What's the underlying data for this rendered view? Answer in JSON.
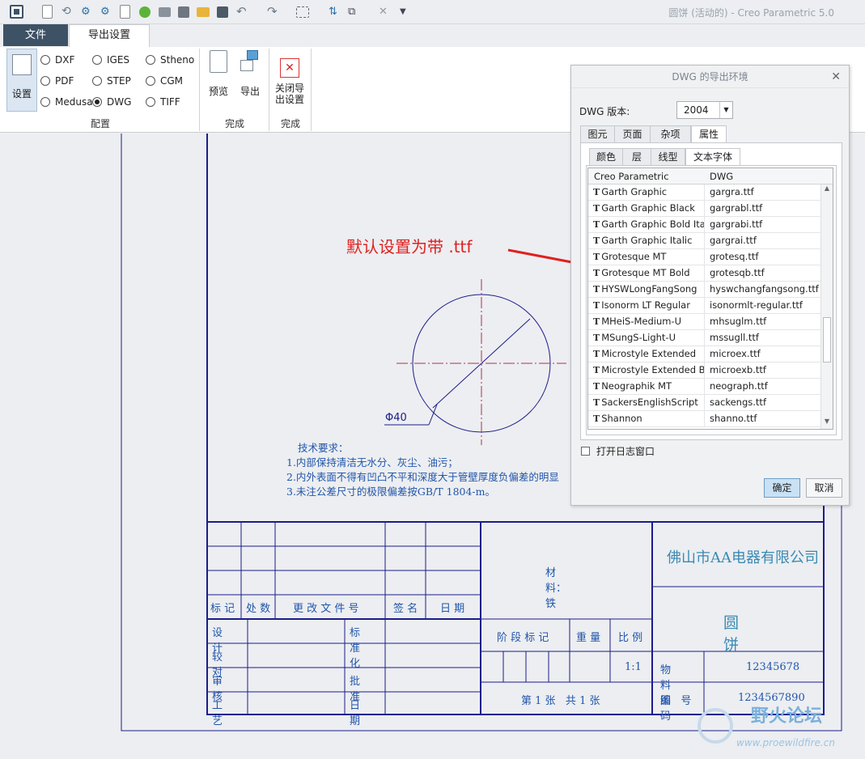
{
  "window": {
    "title": "圆饼 (活动的) - Creo Parametric 5.0"
  },
  "tabs": {
    "file": "文件",
    "export_setup": "导出设置"
  },
  "ribbon": {
    "settings_label": "设置",
    "formats": [
      "DXF",
      "IGES",
      "Stheno",
      "PDF",
      "STEP",
      "CGM",
      "Medusa",
      "DWG",
      "TIFF"
    ],
    "selected_format": "DWG",
    "group_config": "配置",
    "preview_label": "预览",
    "export_label": "导出",
    "close_label_1": "关闭导",
    "close_label_2": "出设置",
    "group_finish_1": "完成",
    "group_finish_2": "完成"
  },
  "annotation": {
    "text": "默认设置为带 .ttf"
  },
  "drawing": {
    "dimension": "Φ40",
    "tech_req": [
      "技术要求：",
      "1.内部保持清洁无水分、灰尘、油污；",
      "2.内外表面不得有凹凸不平和深度大于管壁厚度负偏差的明显",
      "3.未注公差尺寸的极限偏差按GB/T 1804-m。"
    ],
    "titleblock": {
      "header_cells": [
        "标 记",
        "处 数",
        "更 改 文 件 号",
        "签 名",
        "日 期"
      ],
      "design": "设 计",
      "standard": "标准化",
      "check": "较 对",
      "review": "审 核",
      "approve": "批 准",
      "process": "工 艺",
      "date": "日 期",
      "material": "材料：铁",
      "stage": "阶 段 标 记",
      "weight": "重 量",
      "scale": "比 例",
      "scale_value": "1:1",
      "sheet": "第 1 张   共 1 张",
      "company": "佛山市AA电器有限公司",
      "part_name": "圆饼",
      "material_code_label": "物料编码",
      "material_code": "12345678",
      "drawing_no_label": "图   号",
      "drawing_no": "1234567890"
    }
  },
  "watermark": {
    "cn": "野火论坛",
    "url": "www.proewildfire.cn"
  },
  "dialog": {
    "title": "DWG 的导出环境",
    "version_label": "DWG 版本:",
    "version_value": "2004",
    "tabs": [
      "图元",
      "页面",
      "杂项",
      "属性"
    ],
    "subtabs": [
      "颜色",
      "层",
      "线型",
      "文本字体"
    ],
    "col_headers": [
      "Creo Parametric",
      "DWG"
    ],
    "rows": [
      [
        "Garth Graphic",
        "gargra.ttf"
      ],
      [
        "Garth Graphic Black",
        "gargrabl.ttf"
      ],
      [
        "Garth Graphic Bold Ital",
        "gargrabi.ttf"
      ],
      [
        "Garth Graphic Italic",
        "gargrai.ttf"
      ],
      [
        "Grotesque MT",
        "grotesq.ttf"
      ],
      [
        "Grotesque MT Bold",
        "grotesqb.ttf"
      ],
      [
        "HYSWLongFangSong",
        "hyswchangfangsong.ttf"
      ],
      [
        "Isonorm LT Regular",
        "isonormlt-regular.ttf"
      ],
      [
        "MHeiS-Medium-U",
        "mhsuglm.ttf"
      ],
      [
        "MSungS-Light-U",
        "mssugll.ttf"
      ],
      [
        "Microstyle Extended",
        "microex.ttf"
      ],
      [
        "Microstyle Extended Bo",
        "microexb.ttf"
      ],
      [
        "Neographik MT",
        "neograph.ttf"
      ],
      [
        "SackersEnglishScript",
        "sackengs.ttf"
      ],
      [
        "Shannon",
        "shanno.ttf"
      ]
    ],
    "log_label": "打开日志窗口",
    "ok": "确定",
    "cancel": "取消"
  },
  "colors": {
    "accent": "#3e5266",
    "drawing_line": "#1c1c8c",
    "cad_text": "#2255aa",
    "annotation_red": "#e02020",
    "title_text": "#3a8ab3"
  }
}
